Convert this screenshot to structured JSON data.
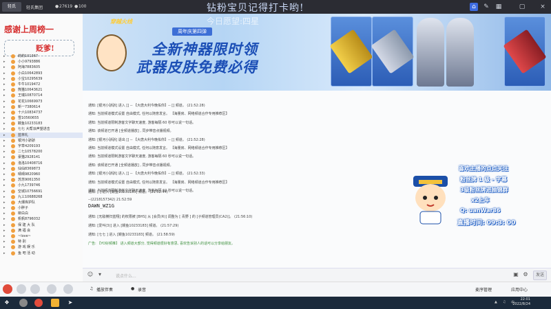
{
  "topbar": {
    "room_name": "轻氏集团",
    "viewers": "27619",
    "fans": "100",
    "wish_text": "钻粉宝贝记得打卡哟!",
    "logo": "轻氏",
    "icons": [
      "home-icon",
      "pen-icon",
      "grid-icon",
      "expand-icon",
      "close-icon"
    ]
  },
  "sidebar": {
    "banner_top": "感谢上周榜一",
    "banner_sub": "贬爹!",
    "users": [
      {
        "name": "莉莉101367",
        "sel": false
      },
      {
        "name": "小小9793886",
        "sel": false
      },
      {
        "name": "阿海7883605",
        "sel": false
      },
      {
        "name": "小白10642893",
        "sel": false
      },
      {
        "name": "小宝10295639",
        "sel": false
      },
      {
        "name": "牛牛1019472",
        "sel": false
      },
      {
        "name": "熊猫10643621",
        "sel": false
      },
      {
        "name": "王瑞10870714",
        "sel": false
      },
      {
        "name": "花花10669973",
        "sel": false
      },
      {
        "name": "新一7380614",
        "sel": false
      },
      {
        "name": "十六10834737",
        "sel": false
      },
      {
        "name": "雪10560655",
        "sel": false
      },
      {
        "name": "鳗鱼10233183",
        "sel": false
      },
      {
        "name": "七七 大帮派声望进击",
        "sel": false
      },
      {
        "name": "蓝林礼",
        "sel": true
      },
      {
        "name": "银河小骄骄",
        "sel": false
      },
      {
        "name": "字草4209193",
        "sel": false
      },
      {
        "name": "二七10578200",
        "sel": false
      },
      {
        "name": "豪猫2928141",
        "sel": false
      },
      {
        "name": "洛洛10408716",
        "sel": false
      },
      {
        "name": "仙仙8369873",
        "sel": false
      },
      {
        "name": "晴晴9820960",
        "sel": false
      },
      {
        "name": "苏苏9061350",
        "sel": false
      },
      {
        "name": "小九1739746",
        "sel": false
      },
      {
        "name": "空城10756691",
        "sel": false
      },
      {
        "name": "九三10688268",
        "sel": false
      },
      {
        "name": "大爆库护队",
        "sel": false
      },
      {
        "name": "小胖子",
        "sel": false
      },
      {
        "name": "柳白白",
        "sel": false
      },
      {
        "name": "帆帆8796032",
        "sel": false
      },
      {
        "name": "保 建 大 队",
        "sel": false
      },
      {
        "name": "满 福 会",
        "sel": false
      },
      {
        "name": "~love~",
        "sel": false
      },
      {
        "name": "特 别",
        "sel": false
      },
      {
        "name": "游 戏 娱 乐",
        "sel": false
      },
      {
        "name": "鱼 吧 活 动",
        "sel": false
      }
    ]
  },
  "ad": {
    "game_logo": "穿越火线",
    "badge": "周年庆第四弹",
    "headline1": "全新神器限时领",
    "headline2": "武器皮肤免费必得",
    "wish_overlay": "今日愿望:四星"
  },
  "chat": {
    "messages": [
      {
        "t": "通知: [银河小骄骄] 进入 [] -- 【大唐大利今晚佑你】-- [] 频道。 (21:52:28)",
        "cls": ""
      },
      {
        "t": "通知: 当前频道模式设置 自由模式, 任何以随意发言。 【海量房、网络频道合作专用推荐区】",
        "cls": ""
      },
      {
        "t": "通知: 当前频道限制游客文字聊天速度, 游客每隔 60 秒可以说一句话。",
        "cls": ""
      },
      {
        "t": "通知: 该频道已开通 [全频道播放] , 同步带音点播视频。",
        "cls": ""
      },
      {
        "t": "通知: [银河小骄骄] 退出 [] -- 【大唐大利今晚佑你】-- [] 频道。 (21:52:28)",
        "cls": ""
      },
      {
        "t": "通知: 当前频道模式设置 自由模式, 任何以随意发言。 【海量房、网络频道合作专用推荐区】",
        "cls": ""
      },
      {
        "t": "通知: 当前频道限制游客文字聊天速度, 游客每隔 60 秒可以说一句话。",
        "cls": ""
      },
      {
        "t": "通知: 该频道已开通 [全频道播放] , 同步带音点播视频。",
        "cls": ""
      },
      {
        "t": "通知: [银河小骄骄] 进入 [] -- 【大唐大利今晚佑你】-- [] 频道。 (21:52:33)",
        "cls": ""
      },
      {
        "t": "通知: 当前频道模式设置 自由模式, 任何以随意发言。 【海量房、网络频道合作专用推荐区】",
        "cls": ""
      },
      {
        "t": "通知: 当前频道限制游客文字聊天速度, 游客每隔 60 秒可以说一句话。",
        "cls": ""
      },
      {
        "t": "通知: [ ] 进入 [鳗鱼10233183] 频道。 (21:52:44)",
        "cls": ""
      },
      {
        "t": "--(2218157342) 21:52:59",
        "cls": "dim"
      },
      {
        "t": "DAWN_WZ1G",
        "cls": "big"
      },
      {
        "t": "通知: [无敌横扫蓝翔] 的权限被 [BHS] 从 [会员(R)] 调整为 [ 青野 ] 的 [子频道管理员(CA2)]。 (21:56:10)",
        "cls": ""
      },
      {
        "t": "通知: [爱叫(3)] 进入 [鳗鱼10233183] 频道。 (21:57:29)",
        "cls": ""
      },
      {
        "t": "通知: [七七 ] 进入 [鳗鱼10233183] 频道。 (21:58:59)",
        "cls": ""
      },
      {
        "t": "广告: 【YO好频推】 进入频道大部分, 觉得频道很好有意思, 喜欢告诉别人的话可以分享给朋友。",
        "cls": "green"
      }
    ]
  },
  "overlay": {
    "line1": "喜欢主播的点点关注",
    "line2": "粉丝牌 1 级 - 字幕",
    "line3": "3级粉丝牌进抽锦群",
    "line4": "x2上车",
    "line5": "Q: uanWar86",
    "line6": "直播时间: 09:3: 00"
  },
  "input": {
    "placeholder": "说点什么...",
    "send_label": "发送"
  },
  "toolbar": {
    "play_label": "播放伴奏",
    "record_label": "录音",
    "mic_label": "麦序管理",
    "app_label": "应用中心"
  },
  "taskbar": {
    "time": "22:01",
    "date": "2022/8/24",
    "lang": "中"
  },
  "colors": {
    "accent": "#3d6be0",
    "banner_red": "#d63030",
    "ad_text": "#1c4fb6"
  }
}
